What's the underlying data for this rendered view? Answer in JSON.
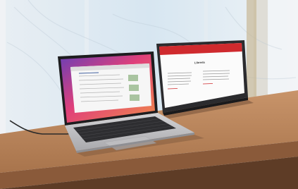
{
  "scene": {
    "colors": {
      "wall": "#f2f2f2",
      "window_blue": "#cfe3f2",
      "wood": "#b8835a",
      "wood_dark": "#8a5a3a",
      "laptop_silver": "#c9c9cb",
      "monitor_header_red": "#cf2a2e",
      "macos_wallpaper": "#e0407a"
    }
  },
  "portable_monitor": {
    "page_title": "Librería",
    "header_link": "",
    "left_column_heading": "",
    "right_column_heading": ""
  }
}
